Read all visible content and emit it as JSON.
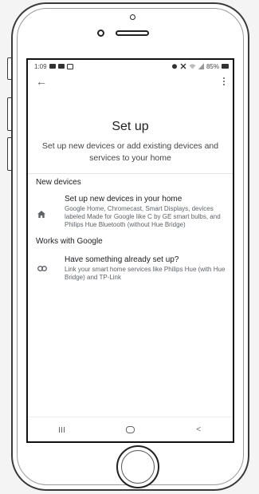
{
  "status_bar": {
    "time": "1:09",
    "battery_percent": "85%",
    "left_icons": [
      "notification-icon",
      "notification-icon",
      "image-icon"
    ],
    "right_icons": [
      "alarm-icon",
      "mute-icon",
      "wifi-icon",
      "signal-icon",
      "battery-icon"
    ]
  },
  "appbar": {
    "back_icon": "arrow-left-icon",
    "menu_icon": "more-vert-icon"
  },
  "page": {
    "title": "Set up",
    "subtitle": "Set up new devices or add existing devices and services to your home"
  },
  "sections": [
    {
      "header": "New devices",
      "item": {
        "icon": "home-icon",
        "title": "Set up new devices in your home",
        "description": "Google Home, Chromecast, Smart Displays, devices labeled Made for Google like C by GE smart bulbs, and Philips Hue Bluetooth (without Hue Bridge)"
      }
    },
    {
      "header": "Works with Google",
      "item": {
        "icon": "link-icon",
        "title": "Have something already set up?",
        "description": "Link your smart home services like Philips Hue (with Hue Bridge) and TP-Link"
      }
    }
  ],
  "nav_bar": {
    "recents_icon": "recents-icon",
    "home_icon": "home-pill-icon",
    "back_label": "<"
  }
}
